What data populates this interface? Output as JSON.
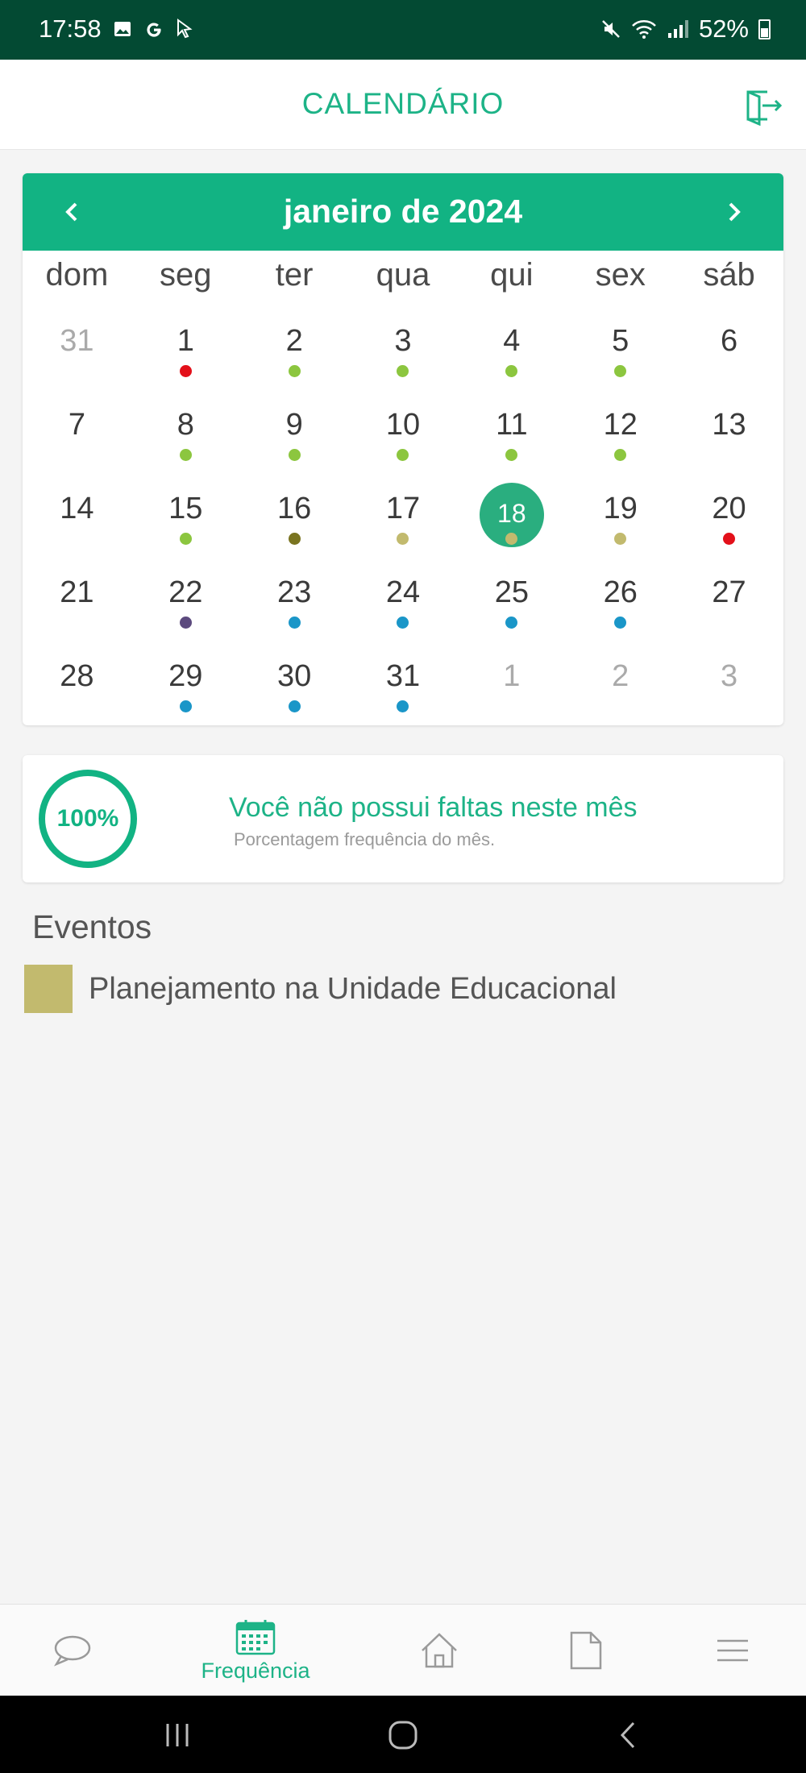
{
  "status_bar": {
    "time": "17:58",
    "left_icons": [
      "image-icon",
      "google-icon",
      "cursor-icon"
    ],
    "right_icons": [
      "mute-icon",
      "wifi-icon",
      "signal-icon"
    ],
    "battery": "52%"
  },
  "header": {
    "title": "CALENDÁRIO",
    "action_icon": "logout-icon"
  },
  "calendar": {
    "month_label": "janeiro de 2024",
    "prev_icon": "chevron-left-icon",
    "next_icon": "chevron-right-icon",
    "weekdays": [
      "dom",
      "seg",
      "ter",
      "qua",
      "qui",
      "sex",
      "sáb"
    ],
    "days": [
      {
        "n": "31",
        "other": true,
        "dot": null
      },
      {
        "n": "1",
        "dot": "#e3101a"
      },
      {
        "n": "2",
        "dot": "#8cc63f"
      },
      {
        "n": "3",
        "dot": "#8cc63f"
      },
      {
        "n": "4",
        "dot": "#8cc63f"
      },
      {
        "n": "5",
        "dot": "#8cc63f"
      },
      {
        "n": "6",
        "dot": null
      },
      {
        "n": "7",
        "dot": null
      },
      {
        "n": "8",
        "dot": "#8cc63f"
      },
      {
        "n": "9",
        "dot": "#8cc63f"
      },
      {
        "n": "10",
        "dot": "#8cc63f"
      },
      {
        "n": "11",
        "dot": "#8cc63f"
      },
      {
        "n": "12",
        "dot": "#8cc63f"
      },
      {
        "n": "13",
        "dot": null
      },
      {
        "n": "14",
        "dot": null
      },
      {
        "n": "15",
        "dot": "#8cc63f"
      },
      {
        "n": "16",
        "dot": "#7a7420"
      },
      {
        "n": "17",
        "dot": "#c2ba6e"
      },
      {
        "n": "18",
        "dot": "#c2ba6e",
        "today": true
      },
      {
        "n": "19",
        "dot": "#c2ba6e"
      },
      {
        "n": "20",
        "dot": "#e3101a"
      },
      {
        "n": "21",
        "dot": null
      },
      {
        "n": "22",
        "dot": "#5c4a7e"
      },
      {
        "n": "23",
        "dot": "#1a96c8"
      },
      {
        "n": "24",
        "dot": "#1a96c8"
      },
      {
        "n": "25",
        "dot": "#1a96c8"
      },
      {
        "n": "26",
        "dot": "#1a96c8"
      },
      {
        "n": "27",
        "dot": null
      },
      {
        "n": "28",
        "dot": null
      },
      {
        "n": "29",
        "dot": "#1a96c8"
      },
      {
        "n": "30",
        "dot": "#1a96c8"
      },
      {
        "n": "31",
        "dot": "#1a96c8"
      },
      {
        "n": "1",
        "other": true,
        "dot": null
      },
      {
        "n": "2",
        "other": true,
        "dot": null
      },
      {
        "n": "3",
        "other": true,
        "dot": null
      }
    ]
  },
  "attendance": {
    "percent_label": "100%",
    "percent": 100,
    "message": "Você não possui faltas neste mês",
    "subtitle": "Porcentagem frequência do mês."
  },
  "events": {
    "title": "Eventos",
    "items": [
      {
        "label": "Planejamento na Unidade Educacional",
        "color": "#c2ba6e"
      }
    ]
  },
  "bottom_nav": {
    "items": [
      {
        "icon": "chat-icon",
        "label": ""
      },
      {
        "icon": "calendar-icon",
        "label": "Frequência",
        "active": true
      },
      {
        "icon": "home-icon",
        "label": ""
      },
      {
        "icon": "document-icon",
        "label": ""
      },
      {
        "icon": "menu-icon",
        "label": ""
      }
    ]
  },
  "colors": {
    "accent": "#12b383",
    "status_bar": "#034a33",
    "today_circle": "#2aae7f"
  }
}
